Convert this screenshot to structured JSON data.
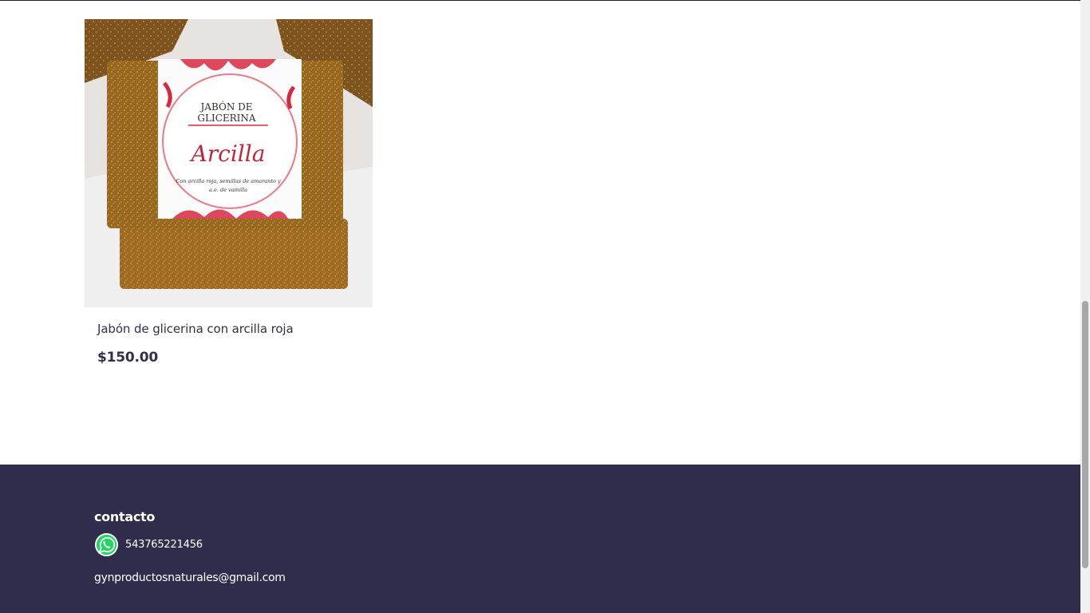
{
  "product": {
    "name": "Jabón de glicerina con arcilla roja",
    "price": "$150.00",
    "image": {
      "label_line1": "JABÓN DE",
      "label_line2": "GLICERINA",
      "label_script": "Arcilla",
      "label_desc_line1": "Con arcilla roja, semillas de amaranto y",
      "label_desc_line2": "a.e. de vainilla"
    }
  },
  "footer": {
    "title": "contacto",
    "phone": "543765221456",
    "email": "gynproductosnaturales@gmail.com",
    "whatsapp_icon": "whatsapp-icon"
  },
  "colors": {
    "footer_bg": "#302d4c",
    "text_primary": "#30304d",
    "whatsapp_green": "#25d366",
    "label_red": "#d8283f"
  }
}
